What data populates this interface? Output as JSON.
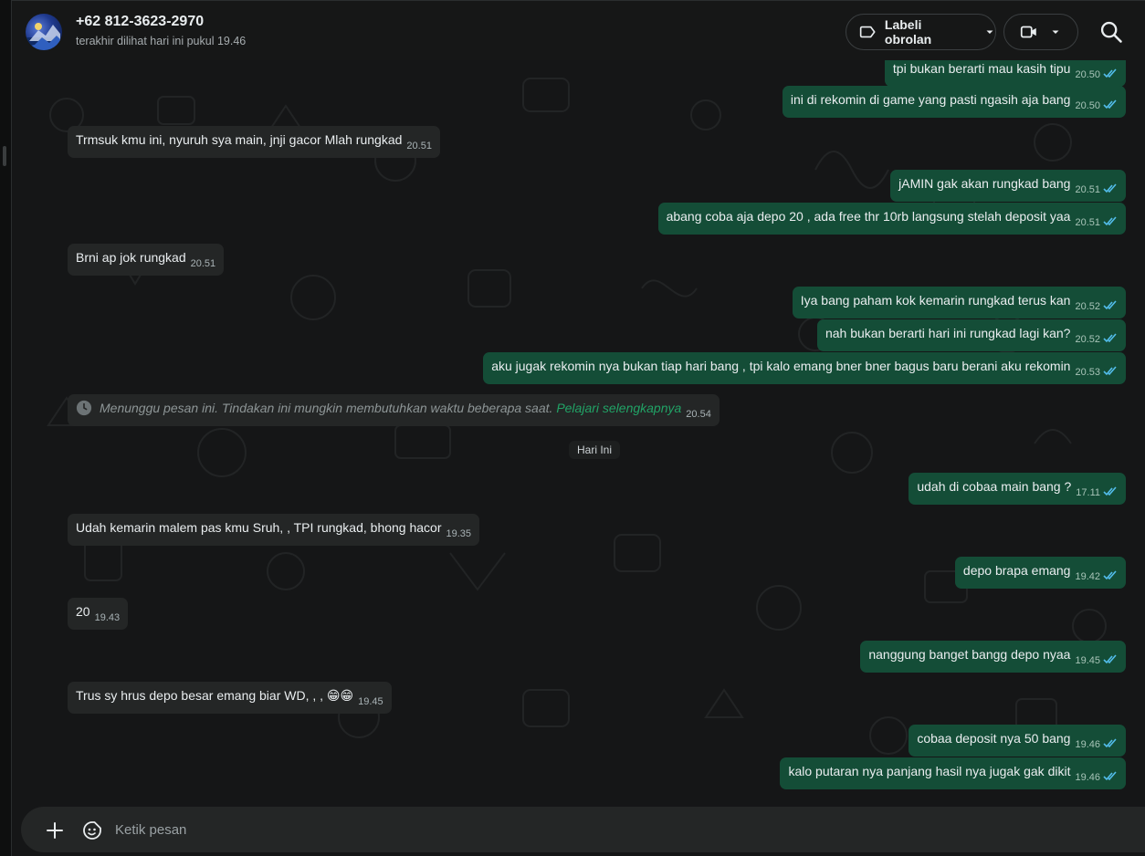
{
  "header": {
    "contact_name": "+62 812-3623-2970",
    "last_seen": "terakhir dilihat hari ini pukul 19.46",
    "label_button": "Labeli obrolan",
    "label_icon": "label-icon",
    "video_icon": "video-icon",
    "search_icon": "search-icon"
  },
  "messages": [
    {
      "dir": "out",
      "text": "tpi bukan berarti mau kasih tipu",
      "time": "20.50"
    },
    {
      "dir": "out",
      "text": "ini di rekomin di game yang pasti ngasih aja bang",
      "time": "20.50"
    },
    {
      "dir": "in",
      "text": "Trmsuk kmu ini, nyuruh sya main, jnji gacor Mlah rungkad",
      "time": "20.51"
    },
    {
      "dir": "out",
      "text": "jAMIN gak akan rungkad bang",
      "time": "20.51"
    },
    {
      "dir": "out",
      "text": "abang coba aja depo 20 , ada free thr 10rb langsung stelah deposit yaa",
      "time": "20.51"
    },
    {
      "dir": "in",
      "text": "Brni ap jok rungkad",
      "time": "20.51"
    },
    {
      "dir": "out",
      "text": "Iya bang paham kok kemarin rungkad terus kan",
      "time": "20.52"
    },
    {
      "dir": "out",
      "text": "nah bukan berarti hari ini rungkad lagi kan?",
      "time": "20.52"
    },
    {
      "dir": "out",
      "text": "aku jugak rekomin nya bukan tiap hari bang , tpi kalo emang bner bner bagus baru berani aku rekomin",
      "time": "20.53"
    },
    {
      "dir": "out",
      "text": "udah di cobaa main bang ?",
      "time": "17.11"
    },
    {
      "dir": "in",
      "text": "Udah kemarin malem pas kmu Sruh, , TPI rungkad, bhong hacor",
      "time": "19.35"
    },
    {
      "dir": "out",
      "text": "depo brapa emang",
      "time": "19.42"
    },
    {
      "dir": "in",
      "text": "20",
      "time": "19.43"
    },
    {
      "dir": "out",
      "text": "nanggung banget bangg depo nyaa",
      "time": "19.45"
    },
    {
      "dir": "in",
      "text": "Trus sy hrus depo besar emang biar WD, , , 😁😁",
      "time": "19.45"
    },
    {
      "dir": "out",
      "text": "cobaa deposit nya 50 bang",
      "time": "19.46"
    },
    {
      "dir": "out",
      "text": "kalo putaran nya panjang hasil nya jugak gak dikit",
      "time": "19.46"
    }
  ],
  "system_message": {
    "text": "Menunggu pesan ini. Tindakan ini mungkin membutuhkan waktu beberapa saat.",
    "link": "Pelajari selengkapnya",
    "time": "20.54",
    "icon": "clock-icon"
  },
  "day_divider": "Hari Ini",
  "composer": {
    "placeholder": "Ketik pesan",
    "attach_icon": "plus-icon",
    "sticker_icon": "sticker-icon"
  },
  "colors": {
    "outgoing_bubble": "#144d37",
    "incoming_bubble": "#242626",
    "read_ticks": "#53bdeb",
    "link": "#21a366"
  }
}
